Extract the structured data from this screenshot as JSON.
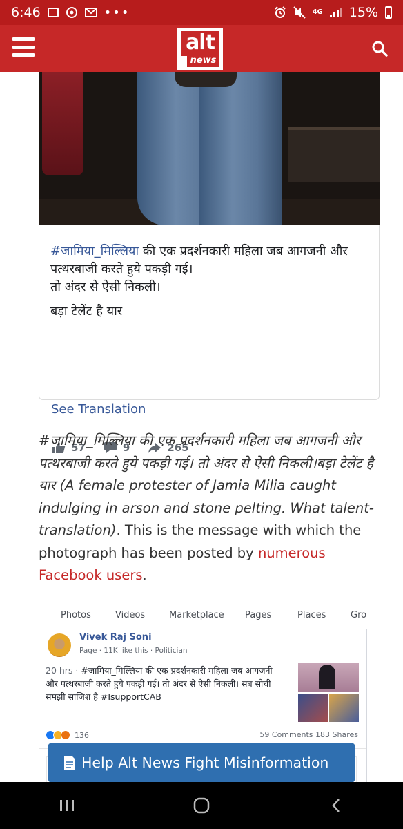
{
  "status_bar": {
    "time": "6:46",
    "notification_dots": "•••",
    "network": "4G",
    "battery": "15%"
  },
  "header": {
    "logo_top": "alt",
    "logo_bottom": "news",
    "menu_icon": "hamburger-menu-icon",
    "search_icon": "search-icon",
    "bg_color": "#c62828"
  },
  "post": {
    "hashtag": "#जामिया_मिल्लिया",
    "line1_rest": " की एक प्रदर्शनकारी महिला जब आगजनी और पत्थरबाजी करते हुये पकड़ी गई।",
    "line2": "तो अंदर से ऐसी निकली।",
    "line3": "बड़ा टेलेंट है यार",
    "see_translation": "See Translation",
    "likes": "57",
    "comments": "9",
    "shares": "265"
  },
  "article": {
    "italic_hindi": "#जामिया_मिल्लिया की एक प्रदर्शनकारी महिला जब आगजनी और पत्थरबाजी करते हुये पकड़ी गई। तो अंदर से ऐसी निकली।बड़ा टेलेंट है यार",
    "italic_english": " (A female protester of Jamia Milia caught indulging in arson and stone pelting. What talent- translation)",
    "plain_text": ". This is the message with which the photograph has been posted by ",
    "link_text": "numerous Facebook users",
    "end": "."
  },
  "fb_screenshot": {
    "tabs": [
      "Photos",
      "Videos",
      "Marketplace",
      "Pages",
      "Places",
      "Gro"
    ],
    "name": "Vivek Raj Soni",
    "meta": "Page · 11K like this · Politician",
    "time": "20 hrs · ",
    "body": "#जामिया_मिल्लिया की एक प्रदर्शनकारी महिला जब आगजनी और पत्थरबाजी करते हुये पकड़ी गई। तो अंदर से ऐसी निकली। सब सोची समझी साजिश है #IsupportCAB",
    "reactions": "136",
    "counts": "59 Comments  183 Shares"
  },
  "cta": {
    "label": "Help Alt News Fight Misinformation",
    "icon": "document-icon",
    "bg_color": "#2f6fb0"
  },
  "nav": {
    "recent_icon": "recent-apps-icon",
    "home_icon": "home-icon",
    "back_icon": "back-icon"
  }
}
